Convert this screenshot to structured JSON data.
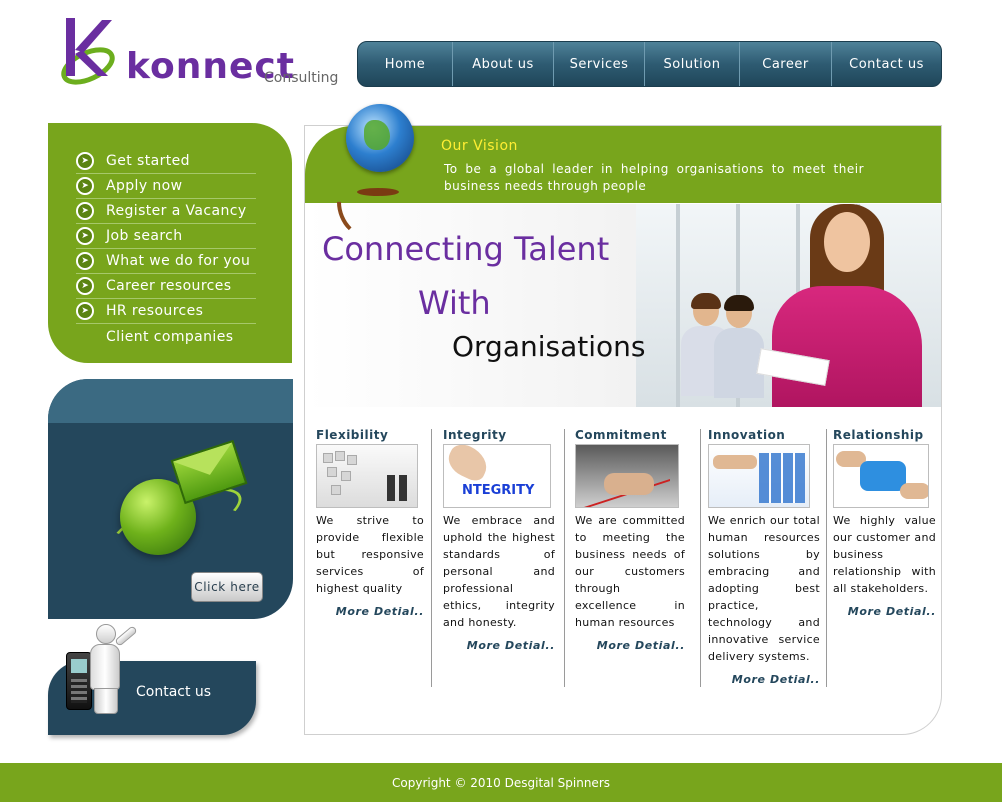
{
  "brand": {
    "name": "konnect",
    "tagline": "Consulting"
  },
  "nav": {
    "items": [
      {
        "label": "Home"
      },
      {
        "label": "About us"
      },
      {
        "label": "Services"
      },
      {
        "label": "Solution"
      },
      {
        "label": "Career"
      },
      {
        "label": "Contact us"
      }
    ]
  },
  "sidebar": {
    "items": [
      {
        "label": "Get started"
      },
      {
        "label": "Apply now"
      },
      {
        "label": "Register a Vacancy"
      },
      {
        "label": "Job search"
      },
      {
        "label": "What we do for you"
      },
      {
        "label": "Career resources"
      },
      {
        "label": "HR resources"
      },
      {
        "label": "Client companies"
      }
    ],
    "click_button": "Click here",
    "contact_label": "Contact us"
  },
  "vision": {
    "title": "Our Vision",
    "text": "To be a global leader in helping organisations to meet their business needs through people"
  },
  "banner": {
    "line1": "Connecting Talent",
    "line2": "With",
    "line3": "Organisations"
  },
  "values": [
    {
      "title": "Flexibility",
      "text": "We strive to provide flexible but responsive services of highest quality",
      "more": "More Detial.."
    },
    {
      "title": "Integrity",
      "thumb_word": "NTEGRITY",
      "text": "We embrace and uphold the highest standards of personal and professional ethics, integrity and honesty.",
      "more": "More Detial.."
    },
    {
      "title": "Commitment",
      "text": "We are committed to meeting the business needs of our customers through excellence in human resources",
      "more": "More Detial.."
    },
    {
      "title": "Innovation",
      "text": "We enrich our total human resources solutions by embracing and adopting best practice, technology and innovative service delivery systems.",
      "more": "More Detial.."
    },
    {
      "title": "Relationship",
      "text": "We highly value our customer and business relationship with all stakeholders.",
      "more": "More Detial.."
    }
  ],
  "footer": {
    "text": "Copyright © 2010 Desgital Spinners"
  },
  "colors": {
    "green": "#78a51c",
    "navy": "#24475c",
    "purple": "#6a2ea0",
    "vision_title": "#ffee33"
  }
}
